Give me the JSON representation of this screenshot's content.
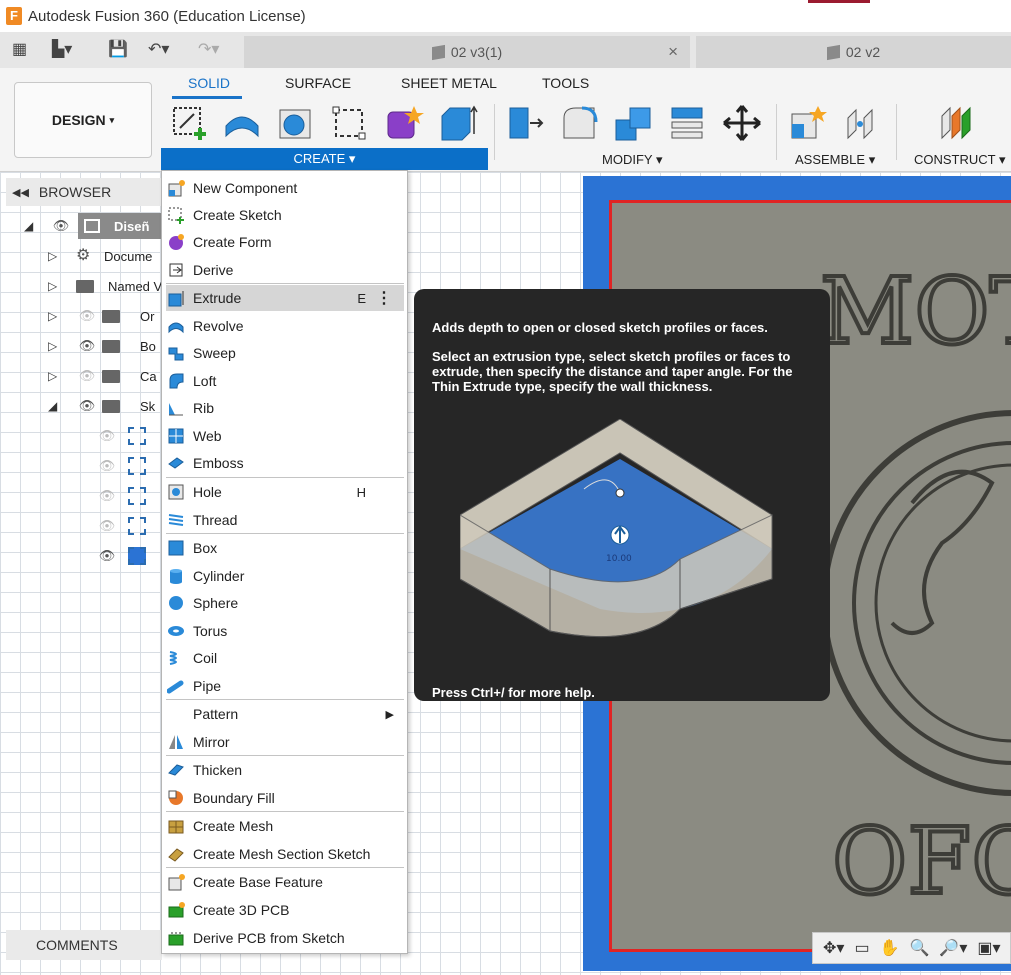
{
  "window": {
    "title": "Autodesk Fusion 360 (Education License)",
    "logo_letter": "F"
  },
  "doc_tabs": [
    {
      "label": "02 v3(1)",
      "close": "×"
    },
    {
      "label": "02 v2"
    }
  ],
  "ribbon": {
    "workspace": "DESIGN",
    "tabs": [
      "SOLID",
      "SURFACE",
      "SHEET METAL",
      "TOOLS"
    ],
    "groups": {
      "create": "CREATE",
      "modify": "MODIFY",
      "assemble": "ASSEMBLE",
      "construct": "CONSTRUCT"
    },
    "caret": "▾"
  },
  "browser": {
    "title": "BROWSER",
    "root": "Diseñ",
    "items": [
      "Docume",
      "Named V",
      "Or",
      "Bo",
      "Ca",
      "Sk"
    ]
  },
  "comments": "COMMENTS",
  "create_menu": {
    "items": [
      {
        "label": "New Component"
      },
      {
        "label": "Create Sketch"
      },
      {
        "label": "Create Form"
      },
      {
        "label": "Derive"
      },
      {
        "label": "Extrude",
        "shortcut": "E",
        "more": "⋮"
      },
      {
        "label": "Revolve"
      },
      {
        "label": "Sweep"
      },
      {
        "label": "Loft"
      },
      {
        "label": "Rib"
      },
      {
        "label": "Web"
      },
      {
        "label": "Emboss"
      },
      {
        "label": "Hole",
        "shortcut": "H"
      },
      {
        "label": "Thread"
      },
      {
        "label": "Box"
      },
      {
        "label": "Cylinder"
      },
      {
        "label": "Sphere"
      },
      {
        "label": "Torus"
      },
      {
        "label": "Coil"
      },
      {
        "label": "Pipe"
      },
      {
        "label": "Pattern"
      },
      {
        "label": "Mirror"
      },
      {
        "label": "Thicken"
      },
      {
        "label": "Boundary Fill"
      },
      {
        "label": "Create Mesh"
      },
      {
        "label": "Create Mesh Section Sketch"
      },
      {
        "label": "Create Base Feature"
      },
      {
        "label": "Create 3D PCB"
      },
      {
        "label": "Derive PCB from Sketch"
      }
    ]
  },
  "tooltip": {
    "title": "Adds depth to open or closed sketch profiles or faces.",
    "body": "Select an extrusion type, select sketch profiles or faces to extrude, then specify the distance and taper angle. For the Thin Extrude type, specify the wall thickness.",
    "footer": "Press Ctrl+/ for more help.",
    "dimension": "10.00"
  },
  "viewport_text": {
    "top": "MOT",
    "bottom": "OFC"
  }
}
